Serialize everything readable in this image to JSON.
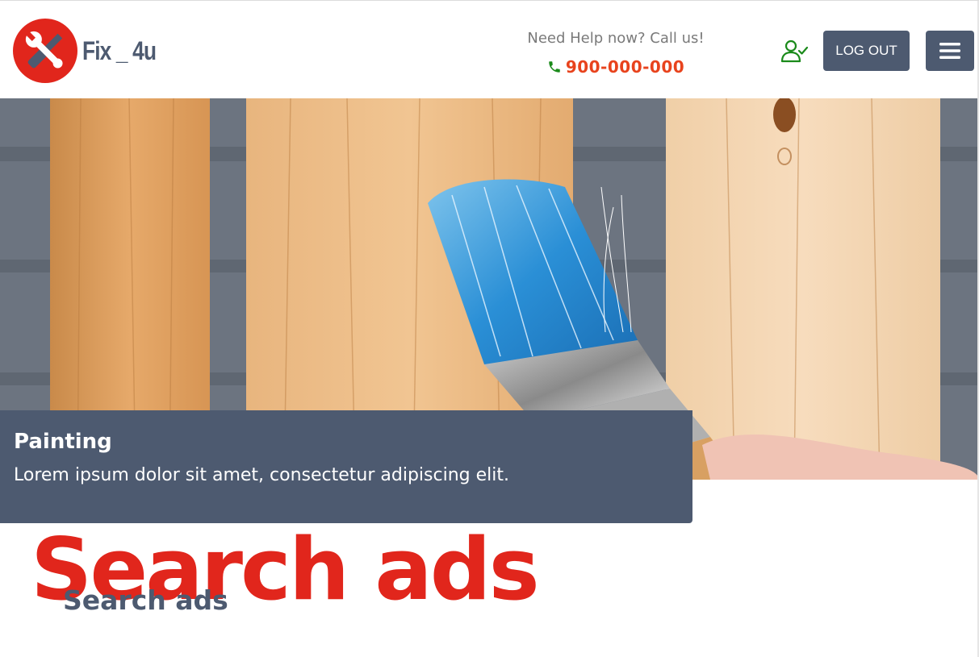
{
  "header": {
    "logo_text": "Fix _ 4u",
    "help_text": "Need Help now? Call us!",
    "phone_number": "900-000-000",
    "logout_label": "LOG OUT",
    "icons": [
      "wrench-screwdriver-logo-icon",
      "phone-icon",
      "user-check-icon",
      "hamburger-menu-icon"
    ]
  },
  "hero": {
    "title": "Painting",
    "text": "Lorem ipsum dolor sit amet, consectetur adipiscing elit."
  },
  "search": {
    "big_heading": "Search ads",
    "small_heading": "Search ads"
  },
  "colors": {
    "brand_red": "#e1261c",
    "phone_orange": "#e8431d",
    "slate": "#4d5a70",
    "phone_icon_green": "#1a8a1a"
  }
}
